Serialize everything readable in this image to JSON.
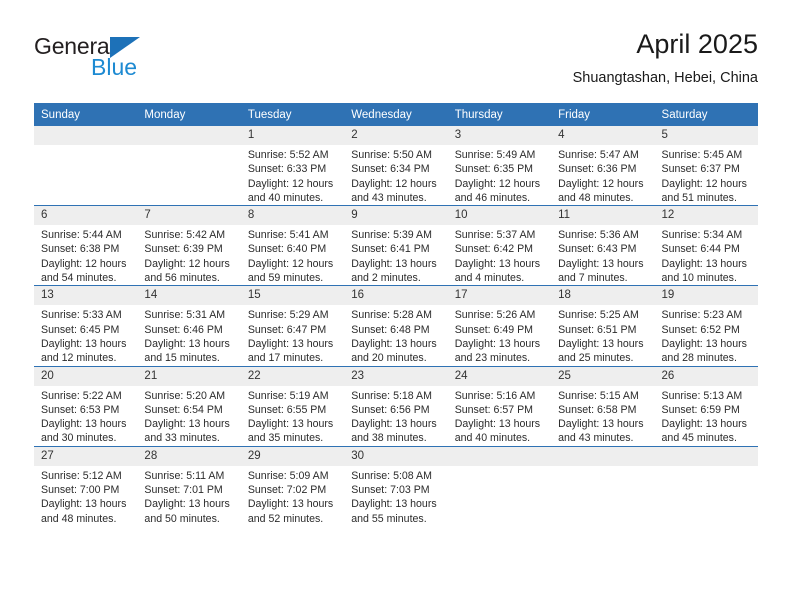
{
  "brand": {
    "name_part1": "General",
    "name_part2": "Blue",
    "accent_color": "#1d8ad2",
    "triangle_color": "#1d71b8"
  },
  "header": {
    "title": "April 2025",
    "subtitle": "Shuangtashan, Hebei, China"
  },
  "theme": {
    "header_blue": "#2f72b4",
    "daynum_bg": "#eeeeee",
    "text": "#2b2b2b"
  },
  "weekday_headers": [
    "Sunday",
    "Monday",
    "Tuesday",
    "Wednesday",
    "Thursday",
    "Friday",
    "Saturday"
  ],
  "weeks": [
    [
      {
        "day": "",
        "sunrise": "",
        "sunset": "",
        "daylight_line1": "",
        "daylight_line2": ""
      },
      {
        "day": "",
        "sunrise": "",
        "sunset": "",
        "daylight_line1": "",
        "daylight_line2": ""
      },
      {
        "day": "1",
        "sunrise": "Sunrise: 5:52 AM",
        "sunset": "Sunset: 6:33 PM",
        "daylight_line1": "Daylight: 12 hours",
        "daylight_line2": "and 40 minutes."
      },
      {
        "day": "2",
        "sunrise": "Sunrise: 5:50 AM",
        "sunset": "Sunset: 6:34 PM",
        "daylight_line1": "Daylight: 12 hours",
        "daylight_line2": "and 43 minutes."
      },
      {
        "day": "3",
        "sunrise": "Sunrise: 5:49 AM",
        "sunset": "Sunset: 6:35 PM",
        "daylight_line1": "Daylight: 12 hours",
        "daylight_line2": "and 46 minutes."
      },
      {
        "day": "4",
        "sunrise": "Sunrise: 5:47 AM",
        "sunset": "Sunset: 6:36 PM",
        "daylight_line1": "Daylight: 12 hours",
        "daylight_line2": "and 48 minutes."
      },
      {
        "day": "5",
        "sunrise": "Sunrise: 5:45 AM",
        "sunset": "Sunset: 6:37 PM",
        "daylight_line1": "Daylight: 12 hours",
        "daylight_line2": "and 51 minutes."
      }
    ],
    [
      {
        "day": "6",
        "sunrise": "Sunrise: 5:44 AM",
        "sunset": "Sunset: 6:38 PM",
        "daylight_line1": "Daylight: 12 hours",
        "daylight_line2": "and 54 minutes."
      },
      {
        "day": "7",
        "sunrise": "Sunrise: 5:42 AM",
        "sunset": "Sunset: 6:39 PM",
        "daylight_line1": "Daylight: 12 hours",
        "daylight_line2": "and 56 minutes."
      },
      {
        "day": "8",
        "sunrise": "Sunrise: 5:41 AM",
        "sunset": "Sunset: 6:40 PM",
        "daylight_line1": "Daylight: 12 hours",
        "daylight_line2": "and 59 minutes."
      },
      {
        "day": "9",
        "sunrise": "Sunrise: 5:39 AM",
        "sunset": "Sunset: 6:41 PM",
        "daylight_line1": "Daylight: 13 hours",
        "daylight_line2": "and 2 minutes."
      },
      {
        "day": "10",
        "sunrise": "Sunrise: 5:37 AM",
        "sunset": "Sunset: 6:42 PM",
        "daylight_line1": "Daylight: 13 hours",
        "daylight_line2": "and 4 minutes."
      },
      {
        "day": "11",
        "sunrise": "Sunrise: 5:36 AM",
        "sunset": "Sunset: 6:43 PM",
        "daylight_line1": "Daylight: 13 hours",
        "daylight_line2": "and 7 minutes."
      },
      {
        "day": "12",
        "sunrise": "Sunrise: 5:34 AM",
        "sunset": "Sunset: 6:44 PM",
        "daylight_line1": "Daylight: 13 hours",
        "daylight_line2": "and 10 minutes."
      }
    ],
    [
      {
        "day": "13",
        "sunrise": "Sunrise: 5:33 AM",
        "sunset": "Sunset: 6:45 PM",
        "daylight_line1": "Daylight: 13 hours",
        "daylight_line2": "and 12 minutes."
      },
      {
        "day": "14",
        "sunrise": "Sunrise: 5:31 AM",
        "sunset": "Sunset: 6:46 PM",
        "daylight_line1": "Daylight: 13 hours",
        "daylight_line2": "and 15 minutes."
      },
      {
        "day": "15",
        "sunrise": "Sunrise: 5:29 AM",
        "sunset": "Sunset: 6:47 PM",
        "daylight_line1": "Daylight: 13 hours",
        "daylight_line2": "and 17 minutes."
      },
      {
        "day": "16",
        "sunrise": "Sunrise: 5:28 AM",
        "sunset": "Sunset: 6:48 PM",
        "daylight_line1": "Daylight: 13 hours",
        "daylight_line2": "and 20 minutes."
      },
      {
        "day": "17",
        "sunrise": "Sunrise: 5:26 AM",
        "sunset": "Sunset: 6:49 PM",
        "daylight_line1": "Daylight: 13 hours",
        "daylight_line2": "and 23 minutes."
      },
      {
        "day": "18",
        "sunrise": "Sunrise: 5:25 AM",
        "sunset": "Sunset: 6:51 PM",
        "daylight_line1": "Daylight: 13 hours",
        "daylight_line2": "and 25 minutes."
      },
      {
        "day": "19",
        "sunrise": "Sunrise: 5:23 AM",
        "sunset": "Sunset: 6:52 PM",
        "daylight_line1": "Daylight: 13 hours",
        "daylight_line2": "and 28 minutes."
      }
    ],
    [
      {
        "day": "20",
        "sunrise": "Sunrise: 5:22 AM",
        "sunset": "Sunset: 6:53 PM",
        "daylight_line1": "Daylight: 13 hours",
        "daylight_line2": "and 30 minutes."
      },
      {
        "day": "21",
        "sunrise": "Sunrise: 5:20 AM",
        "sunset": "Sunset: 6:54 PM",
        "daylight_line1": "Daylight: 13 hours",
        "daylight_line2": "and 33 minutes."
      },
      {
        "day": "22",
        "sunrise": "Sunrise: 5:19 AM",
        "sunset": "Sunset: 6:55 PM",
        "daylight_line1": "Daylight: 13 hours",
        "daylight_line2": "and 35 minutes."
      },
      {
        "day": "23",
        "sunrise": "Sunrise: 5:18 AM",
        "sunset": "Sunset: 6:56 PM",
        "daylight_line1": "Daylight: 13 hours",
        "daylight_line2": "and 38 minutes."
      },
      {
        "day": "24",
        "sunrise": "Sunrise: 5:16 AM",
        "sunset": "Sunset: 6:57 PM",
        "daylight_line1": "Daylight: 13 hours",
        "daylight_line2": "and 40 minutes."
      },
      {
        "day": "25",
        "sunrise": "Sunrise: 5:15 AM",
        "sunset": "Sunset: 6:58 PM",
        "daylight_line1": "Daylight: 13 hours",
        "daylight_line2": "and 43 minutes."
      },
      {
        "day": "26",
        "sunrise": "Sunrise: 5:13 AM",
        "sunset": "Sunset: 6:59 PM",
        "daylight_line1": "Daylight: 13 hours",
        "daylight_line2": "and 45 minutes."
      }
    ],
    [
      {
        "day": "27",
        "sunrise": "Sunrise: 5:12 AM",
        "sunset": "Sunset: 7:00 PM",
        "daylight_line1": "Daylight: 13 hours",
        "daylight_line2": "and 48 minutes."
      },
      {
        "day": "28",
        "sunrise": "Sunrise: 5:11 AM",
        "sunset": "Sunset: 7:01 PM",
        "daylight_line1": "Daylight: 13 hours",
        "daylight_line2": "and 50 minutes."
      },
      {
        "day": "29",
        "sunrise": "Sunrise: 5:09 AM",
        "sunset": "Sunset: 7:02 PM",
        "daylight_line1": "Daylight: 13 hours",
        "daylight_line2": "and 52 minutes."
      },
      {
        "day": "30",
        "sunrise": "Sunrise: 5:08 AM",
        "sunset": "Sunset: 7:03 PM",
        "daylight_line1": "Daylight: 13 hours",
        "daylight_line2": "and 55 minutes."
      },
      {
        "day": "",
        "sunrise": "",
        "sunset": "",
        "daylight_line1": "",
        "daylight_line2": ""
      },
      {
        "day": "",
        "sunrise": "",
        "sunset": "",
        "daylight_line1": "",
        "daylight_line2": ""
      },
      {
        "day": "",
        "sunrise": "",
        "sunset": "",
        "daylight_line1": "",
        "daylight_line2": ""
      }
    ]
  ]
}
